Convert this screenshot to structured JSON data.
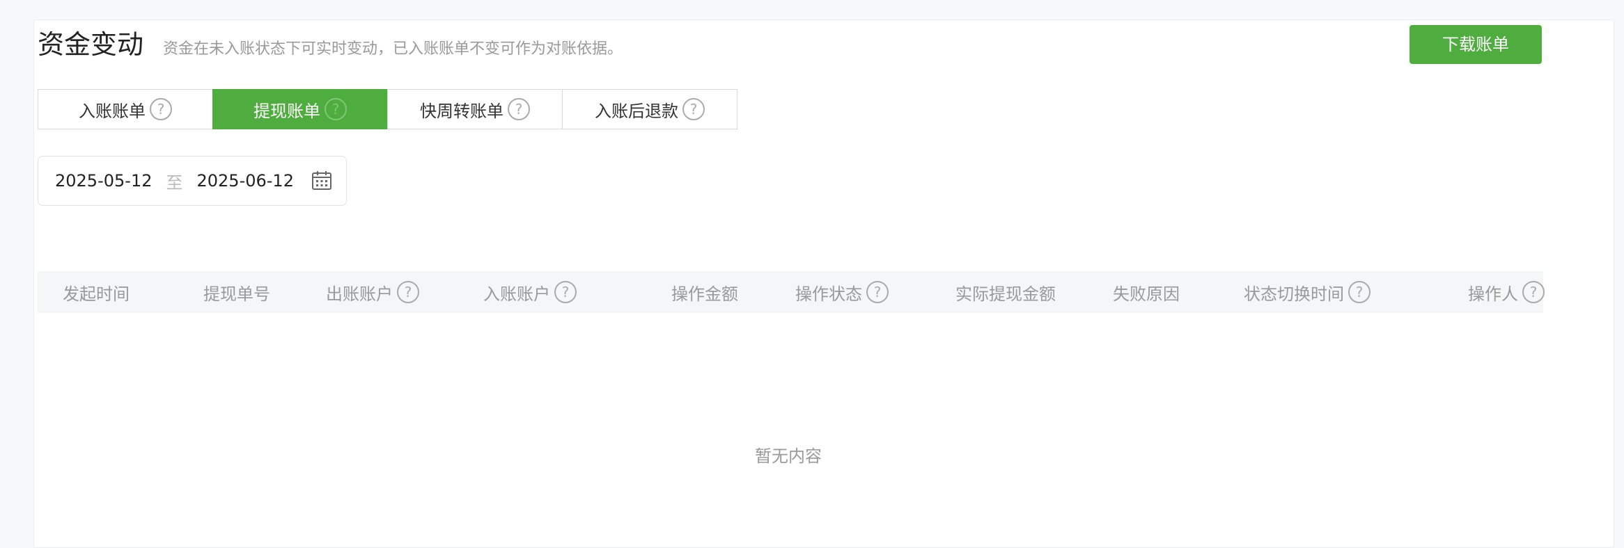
{
  "header": {
    "title": "资金变动",
    "subtitle": "资金在未入账状态下可实时变动，已入账账单不变可作为对账依据。",
    "download_label": "下载账单"
  },
  "tabs": [
    {
      "label": "入账账单",
      "active": false
    },
    {
      "label": "提现账单",
      "active": true
    },
    {
      "label": "快周转账单",
      "active": false
    },
    {
      "label": "入账后退款",
      "active": false
    }
  ],
  "date_range": {
    "start": "2025-05-12",
    "separator": "至",
    "end": "2025-06-12"
  },
  "table": {
    "columns": [
      {
        "label": "发起时间",
        "help": false
      },
      {
        "label": "提现单号",
        "help": false
      },
      {
        "label": "出账账户",
        "help": true
      },
      {
        "label": "入账账户",
        "help": true
      },
      {
        "label": "操作金额",
        "help": false
      },
      {
        "label": "操作状态",
        "help": true
      },
      {
        "label": "实际提现金额",
        "help": false
      },
      {
        "label": "失败原因",
        "help": false
      },
      {
        "label": "状态切换时间",
        "help": true
      },
      {
        "label": "操作人",
        "help": true
      }
    ],
    "empty_text": "暂无内容"
  },
  "colors": {
    "accent": "#4fad3f"
  }
}
